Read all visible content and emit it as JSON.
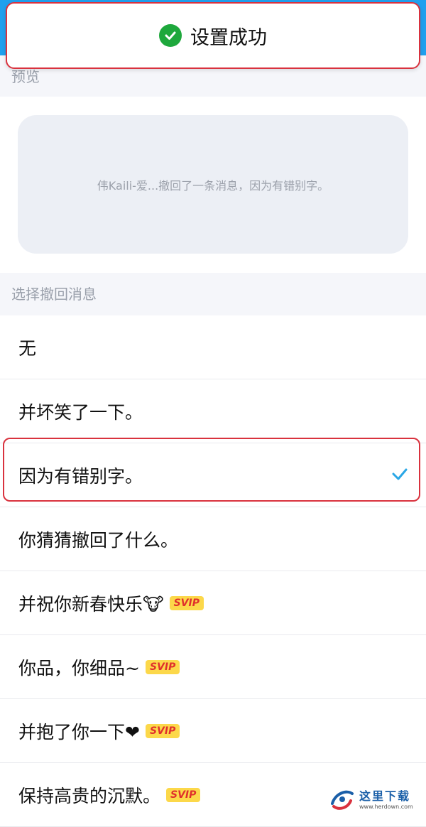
{
  "toast": {
    "text": "设置成功",
    "icon": "check-circle-icon",
    "color": "#1ea83c"
  },
  "preview": {
    "header": "预览",
    "message": "伟Kaili-爱...撤回了一条消息，因为有错别字。"
  },
  "select": {
    "header": "选择撤回消息",
    "options": [
      {
        "label": "无",
        "svip": ""
      },
      {
        "label": "并坏笑了一下。",
        "svip": ""
      },
      {
        "label": "因为有错别字。",
        "svip": "",
        "selected": true
      },
      {
        "label": "你猜猜撤回了什么。",
        "svip": ""
      },
      {
        "label": "并祝你新春快乐🐮",
        "svip": "SVIP"
      },
      {
        "label": "你品，你细品~",
        "svip": "SVIP"
      },
      {
        "label": "并抱了你一下❤",
        "svip": "SVIP"
      },
      {
        "label": "保持高贵的沉默。",
        "svip": "SVIP"
      }
    ]
  },
  "watermark": {
    "cn": "这里下载",
    "url": "www.herdown.com"
  },
  "colors": {
    "accent": "#1fa0ee",
    "check": "#2aa7e6",
    "highlight": "#d9323e"
  }
}
